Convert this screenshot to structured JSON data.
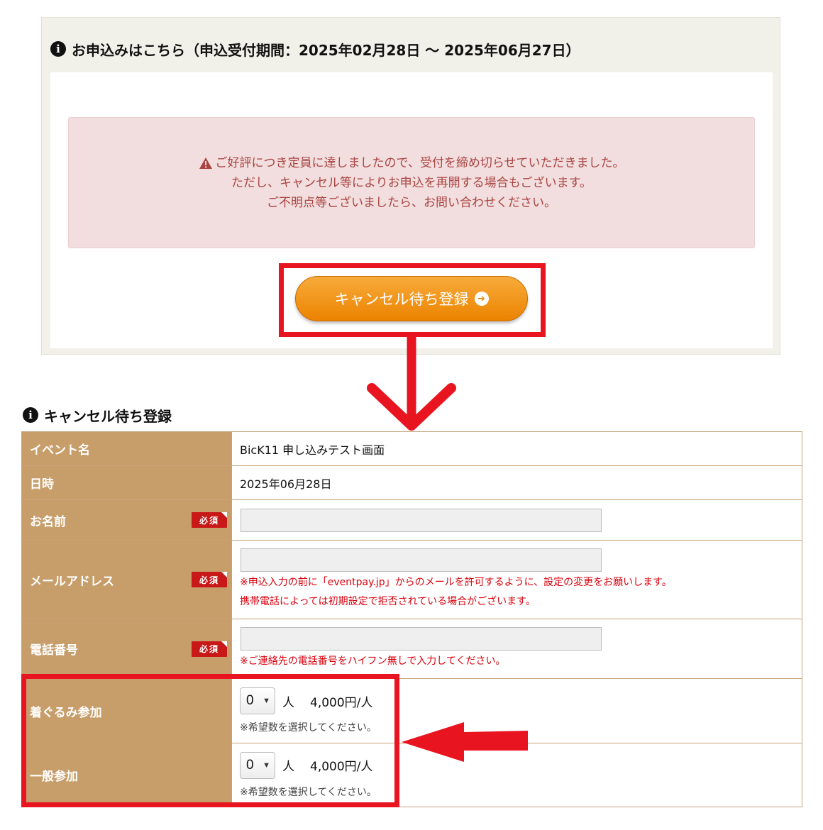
{
  "panel": {
    "title": "お申込みはこちら（申込受付期間：2025年02月28日 〜 2025年06月27日）",
    "info_icon": "i",
    "alert": {
      "icon": "warning-triangle-icon",
      "lines": [
        "ご好評につき定員に達しましたので、受付を締め切らせていただきました。",
        "ただし、キャンセル等によりお申込を再開する場合もございます。",
        "ご不明点等ございましたら、お問い合わせください。"
      ]
    },
    "waitlist_button": {
      "label": "キャンセル待ち登録",
      "icon": "arrow-circle-right-icon"
    }
  },
  "form": {
    "title": "キャンセル待ち登録",
    "required_badge": "必須",
    "rows": {
      "event_name": {
        "label": "イベント名",
        "value": "BicK11 申し込みテスト画面"
      },
      "date": {
        "label": "日時",
        "value": "2025年06月28日"
      },
      "name": {
        "label": "お名前",
        "value": "",
        "placeholder": ""
      },
      "email": {
        "label": "メールアドレス",
        "value": "",
        "placeholder": "",
        "notes": [
          "※申込入力の前に「eventpay.jp」からのメールを許可するように、設定の変更をお願いします。",
          "携帯電話によっては初期設定で拒否されている場合がございます。"
        ]
      },
      "phone": {
        "label": "電話番号",
        "value": "",
        "placeholder": "",
        "note": "※ご連絡先の電話番号をハイフン無しで入力してください。"
      },
      "kigurumi": {
        "label": "着ぐるみ参加",
        "selected": "0",
        "unit": "人",
        "price": "4,000円/人",
        "note": "※希望数を選択してください。"
      },
      "general": {
        "label": "一般参加",
        "selected": "0",
        "unit": "人",
        "price": "4,000円/人",
        "note": "※希望数を選択してください。"
      }
    }
  },
  "annotation_color": "#e8141f"
}
